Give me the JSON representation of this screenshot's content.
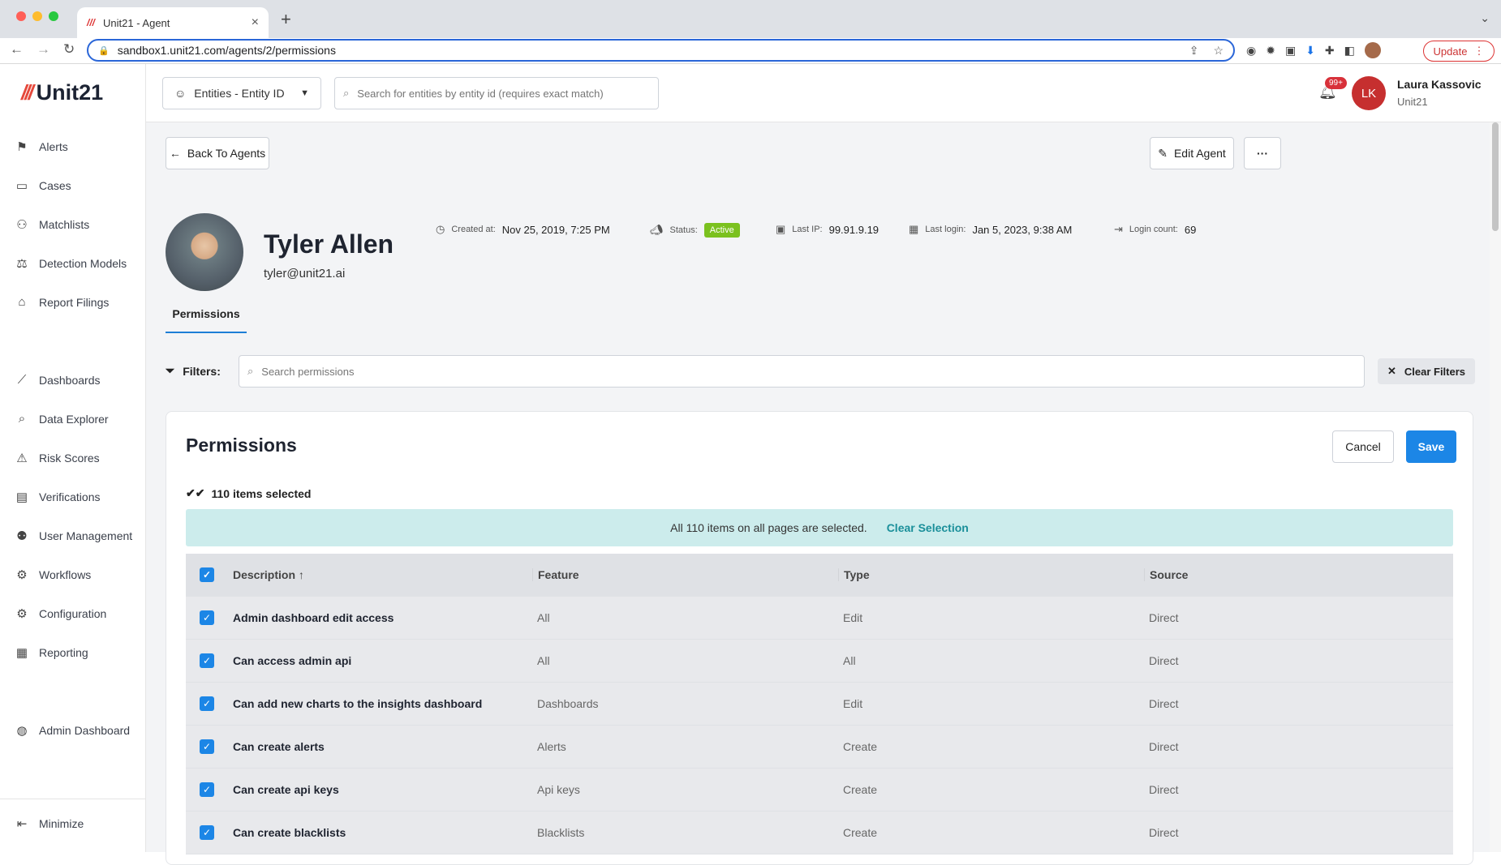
{
  "browser": {
    "tab_title": "Unit21 - Agent",
    "url": "sandbox1.unit21.com/agents/2/permissions",
    "update_label": "Update"
  },
  "sidebar": {
    "brand": "Unit21",
    "items": [
      {
        "label": "Alerts",
        "icon": "flag-icon"
      },
      {
        "label": "Cases",
        "icon": "briefcase-icon"
      },
      {
        "label": "Matchlists",
        "icon": "user-x-icon"
      },
      {
        "label": "Detection Models",
        "icon": "scale-icon"
      },
      {
        "label": "Report Filings",
        "icon": "bank-icon"
      },
      {
        "label": "Dashboards",
        "icon": "chart-line-icon"
      },
      {
        "label": "Data Explorer",
        "icon": "search-doc-icon"
      },
      {
        "label": "Risk Scores",
        "icon": "warning-icon"
      },
      {
        "label": "Verifications",
        "icon": "id-card-icon"
      },
      {
        "label": "User Management",
        "icon": "users-icon"
      },
      {
        "label": "Workflows",
        "icon": "workflow-icon"
      },
      {
        "label": "Configuration",
        "icon": "gear-icon"
      },
      {
        "label": "Reporting",
        "icon": "report-icon"
      },
      {
        "label": "Admin Dashboard",
        "icon": "globe-icon"
      },
      {
        "label": "Minimize",
        "icon": "collapse-icon"
      }
    ]
  },
  "topbar": {
    "entity_select": "Entities - Entity ID",
    "search_placeholder": "Search for entities by entity id (requires exact match)",
    "notif_count": "99+",
    "user_initials": "LK",
    "user_name": "Laura Kassovic",
    "user_org": "Unit21"
  },
  "agent": {
    "back_label": "Back To Agents",
    "edit_label": "Edit Agent",
    "more_label": "···",
    "name": "Tyler Allen",
    "email": "tyler@unit21.ai",
    "created_label": "Created at:",
    "created_value": "Nov 25, 2019, 7:25 PM",
    "status_label": "Status:",
    "status_value": "Active",
    "ip_label": "Last IP:",
    "ip_value": "99.91.9.19",
    "login_label": "Last login:",
    "login_value": "Jan 5, 2023, 9:38 AM",
    "count_label": "Login count:",
    "count_value": "69",
    "tab": "Permissions"
  },
  "filters": {
    "label": "Filters:",
    "placeholder": "Search permissions",
    "clear_label": "Clear Filters"
  },
  "permissions": {
    "title": "Permissions",
    "cancel_label": "Cancel",
    "save_label": "Save",
    "selected_text": "110 items selected",
    "banner_text": "All 110 items on all pages are selected.",
    "clear_selection": "Clear Selection",
    "columns": [
      "Description",
      "Feature",
      "Type",
      "Source"
    ],
    "rows": [
      [
        "Admin dashboard edit access",
        "All",
        "Edit",
        "Direct"
      ],
      [
        "Can access admin api",
        "All",
        "All",
        "Direct"
      ],
      [
        "Can add new charts to the insights dashboard",
        "Dashboards",
        "Edit",
        "Direct"
      ],
      [
        "Can create alerts",
        "Alerts",
        "Create",
        "Direct"
      ],
      [
        "Can create api keys",
        "Api keys",
        "Create",
        "Direct"
      ],
      [
        "Can create blacklists",
        "Blacklists",
        "Create",
        "Direct"
      ]
    ]
  }
}
